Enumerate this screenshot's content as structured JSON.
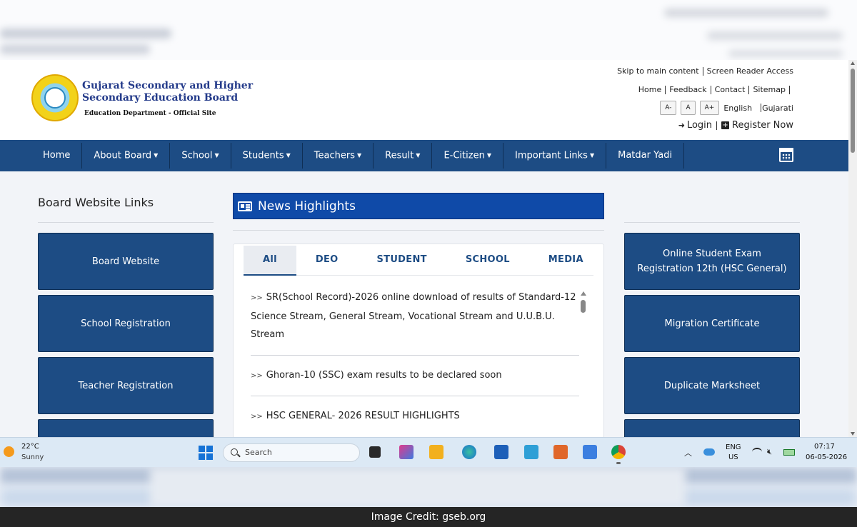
{
  "header": {
    "board_title_line1": "Gujarat Secondary and Higher",
    "board_title_line2": "Secondary Education Board",
    "board_subtitle": "Education Department - Official Site",
    "skip_link": "Skip to main content",
    "screen_reader": "Screen Reader Access",
    "util_links": [
      "Home",
      "Feedback",
      "Contact",
      "Sitemap"
    ],
    "font_buttons": [
      "A-",
      "A",
      "A+"
    ],
    "lang_english": "English",
    "lang_gujarati": "Gujarati",
    "login": "Login",
    "register": "Register Now"
  },
  "nav": {
    "items": [
      {
        "label": "Home",
        "dropdown": false
      },
      {
        "label": "About Board",
        "dropdown": true
      },
      {
        "label": "School",
        "dropdown": true
      },
      {
        "label": "Students",
        "dropdown": true
      },
      {
        "label": "Teachers",
        "dropdown": true
      },
      {
        "label": "Result",
        "dropdown": true
      },
      {
        "label": "E-Citizen",
        "dropdown": true
      },
      {
        "label": "Important Links",
        "dropdown": true
      },
      {
        "label": "Matdar Yadi",
        "dropdown": false
      }
    ],
    "calendar_icon": "calendar-icon"
  },
  "left": {
    "title": "Board Website Links",
    "links": [
      "Board Website",
      "School Registration",
      "Teacher Registration"
    ]
  },
  "news": {
    "title": "News Highlights",
    "tabs": [
      "All",
      "DEO",
      "STUDENT",
      "SCHOOL",
      "MEDIA"
    ],
    "active_tab": "All",
    "arrow": ">>",
    "items": [
      "SR(School Record)-2026 online download of results of Standard-12 Science Stream, General Stream, Vocational Stream and U.U.B.U. Stream",
      "Ghoran-10 (SSC) exam results to be declared soon",
      "HSC GENERAL- 2026 RESULT HIGHLIGHTS"
    ]
  },
  "right": {
    "links": [
      "Online Student Exam Registration 12th (HSC General)",
      "Migration Certificate",
      "Duplicate Marksheet"
    ]
  },
  "taskbar": {
    "temp": "22°C",
    "condition": "Sunny",
    "search_placeholder": "Search",
    "lang_line1": "ENG",
    "lang_line2": "US",
    "time": "07:17",
    "date": "06-05-2026"
  },
  "credit": "Image Credit: gseb.org",
  "colors": {
    "nav_bg": "#1d4c84",
    "news_header_bg": "#0f4aa8",
    "link_box_bg": "#1d4c84",
    "main_bg": "#f2f4f8",
    "taskbar_bg": "#dce9f5"
  }
}
